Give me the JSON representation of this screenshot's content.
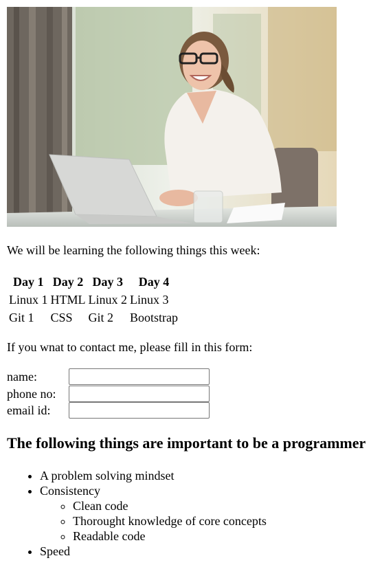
{
  "image": {
    "alt": "",
    "colors": {
      "curtain": "#6e675f",
      "window_light": "#e9ede4",
      "greenery": "#9fb48a",
      "table": "#d9dcd8",
      "blouse": "#f4f1ec",
      "laptop": "#d7d8d6",
      "hair": "#7a5a3e",
      "skin": "#e8b9a0",
      "chair": "#7d7168"
    }
  },
  "intro_text": "We will be learning the following things this week:",
  "schedule": {
    "headers": [
      "Day 1",
      "Day 2",
      "Day 3",
      "Day 4"
    ],
    "rows": [
      [
        "Linux 1",
        "HTML",
        "Linux 2",
        "Linux 3"
      ],
      [
        "Git 1",
        "CSS",
        "Git 2",
        "Bootstrap"
      ]
    ]
  },
  "contact": {
    "intro": "If you wnat to contact me, please fill in this form:",
    "fields": [
      {
        "label": "name:",
        "value": "",
        "placeholder": ""
      },
      {
        "label": "phone no:",
        "value": "",
        "placeholder": ""
      },
      {
        "label": "email id:",
        "value": "",
        "placeholder": ""
      }
    ]
  },
  "important": {
    "heading": "The following things are important to be a programmer",
    "items": [
      "A problem solving mindset",
      "Consistency",
      "Speed"
    ],
    "sub_items": [
      "Clean code",
      "Thorought knowledge of core concepts",
      "Readable code"
    ]
  }
}
